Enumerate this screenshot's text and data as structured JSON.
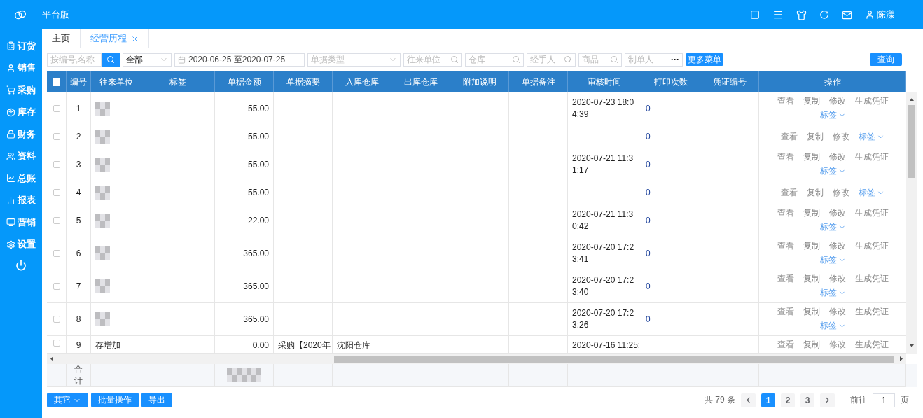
{
  "header": {
    "title": "平台版",
    "user": "陈漾"
  },
  "sidebar": {
    "items": [
      "订货",
      "销售",
      "采购",
      "库存",
      "财务",
      "资料",
      "总账",
      "报表",
      "营销",
      "设置"
    ]
  },
  "tabs": [
    {
      "label": "主页",
      "selected": false,
      "closable": false
    },
    {
      "label": "经营历程",
      "selected": true,
      "closable": true
    }
  ],
  "filters": {
    "search": {
      "placeholder": "按编号,名称"
    },
    "scope": {
      "value": "全部"
    },
    "date_from": "2020-06-25",
    "date_sep": "至",
    "date_to": "2020-07-25",
    "doc_type": {
      "placeholder": "单据类型"
    },
    "partner": {
      "placeholder": "往来单位"
    },
    "warehouse": {
      "placeholder": "仓库"
    },
    "handler": {
      "placeholder": "经手人"
    },
    "goods": {
      "placeholder": "商品"
    },
    "maker": {
      "placeholder": "制单人",
      "more_glyph": "···"
    },
    "more": "更多菜单",
    "query": "查询"
  },
  "table": {
    "select_all_checked": false,
    "columns": [
      "编号",
      "往来单位",
      "标签",
      "单据金额",
      "单据摘要",
      "入库仓库",
      "出库仓库",
      "附加说明",
      "单据备注",
      "审核时间",
      "打印次数",
      "凭证编号",
      "操作"
    ],
    "rows": [
      {
        "no": "1",
        "amount": "55.00",
        "audit_time": "2020-07-23 18:04:39",
        "prints": "0",
        "actions": [
          "查看",
          "复制",
          "修改",
          "生成凭证"
        ],
        "tag": "标签",
        "checked": false
      },
      {
        "no": "2",
        "amount": "55.00",
        "prints": "0",
        "actions": [
          "查看",
          "复制",
          "修改"
        ],
        "tag": "标签",
        "checked": false
      },
      {
        "no": "3",
        "amount": "55.00",
        "audit_time": "2020-07-21 11:31:17",
        "prints": "0",
        "actions": [
          "查看",
          "复制",
          "修改",
          "生成凭证"
        ],
        "tag": "标签",
        "checked": false
      },
      {
        "no": "4",
        "amount": "55.00",
        "prints": "0",
        "actions": [
          "查看",
          "复制",
          "修改"
        ],
        "tag": "标签",
        "checked": false
      },
      {
        "no": "5",
        "amount": "22.00",
        "audit_time": "2020-07-21 11:30:42",
        "prints": "0",
        "actions": [
          "查看",
          "复制",
          "修改",
          "生成凭证"
        ],
        "tag": "标签",
        "checked": false
      },
      {
        "no": "6",
        "amount": "365.00",
        "audit_time": "2020-07-20 17:23:41",
        "prints": "0",
        "actions": [
          "查看",
          "复制",
          "修改",
          "生成凭证"
        ],
        "tag": "标签",
        "checked": false
      },
      {
        "no": "7",
        "amount": "365.00",
        "audit_time": "2020-07-20 17:23:40",
        "prints": "0",
        "actions": [
          "查看",
          "复制",
          "修改",
          "生成凭证"
        ],
        "tag": "标签",
        "checked": false
      },
      {
        "no": "8",
        "amount": "365.00",
        "audit_time": "2020-07-20 17:23:26",
        "prints": "0",
        "actions": [
          "查看",
          "复制",
          "修改",
          "生成凭证"
        ],
        "tag": "标签",
        "checked": false
      },
      {
        "no": "9",
        "partner": "存增加",
        "amount": "0.00",
        "summary": "采购【2020年",
        "in_warehouse": "沈阳仓库",
        "audit_time": "2020-07-16 11:25:",
        "actions": [
          "查看",
          "复制",
          "修改",
          "生成凭证"
        ],
        "checked": false
      }
    ],
    "total_label": "合计"
  },
  "footer": {
    "buttons": [
      "其它",
      "批量操作",
      "导出"
    ],
    "total": "共 79 条",
    "pages": [
      {
        "label": "1",
        "selected": true
      },
      {
        "label": "2",
        "selected": false
      },
      {
        "label": "3",
        "selected": false
      }
    ],
    "goto_label": "前往",
    "goto_value": "1",
    "page_suffix": "页"
  }
}
